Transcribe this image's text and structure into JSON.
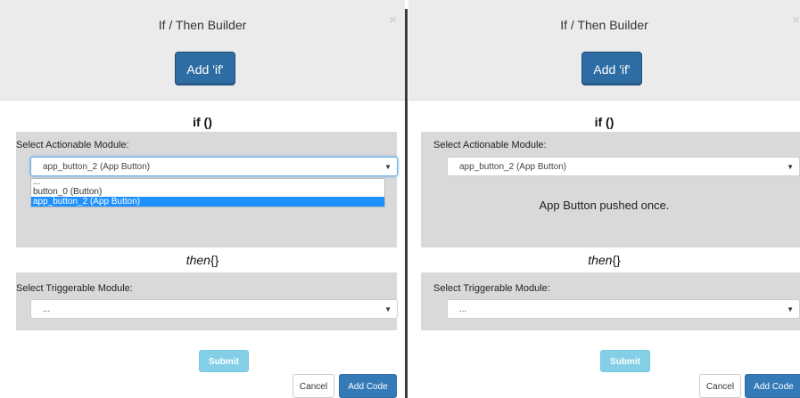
{
  "left": {
    "title": "If / Then Builder",
    "close": "×",
    "add_if_label": "Add 'if'",
    "if_heading": "if ()",
    "actionable_label": "Select Actionable Module:",
    "actionable_value": "app_button_2 (App Button)",
    "dropdown_options": [
      "...",
      "button_0 (Button)",
      "app_button_2 (App Button)"
    ],
    "submit_label": "Submit",
    "then_word": "then",
    "then_braces": "{}",
    "triggerable_label": "Select Triggerable Module:",
    "triggerable_value": "...",
    "cancel_label": "Cancel",
    "add_code_label": "Add Code"
  },
  "right": {
    "title": "If / Then Builder",
    "close": "×",
    "add_if_label": "Add 'if'",
    "if_heading": "if ()",
    "actionable_label": "Select Actionable Module:",
    "actionable_value": "app_button_2 (App Button)",
    "status_message": "App Button pushed once.",
    "submit_label": "Submit",
    "then_word": "then",
    "then_braces": "{}",
    "triggerable_label": "Select Triggerable Module:",
    "triggerable_value": "...",
    "cancel_label": "Cancel",
    "add_code_label": "Add Code"
  },
  "icons": {
    "select_arrow": "▼"
  },
  "colors": {
    "primary": "#337ab7",
    "header_bg": "#ebebeb",
    "box_bg": "#d9d9d9",
    "submit": "#5bc0de",
    "highlight": "#1e90ff"
  }
}
